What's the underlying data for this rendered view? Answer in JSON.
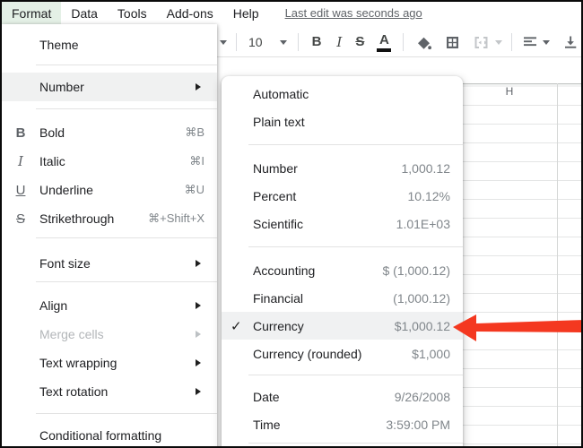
{
  "menubar": {
    "items": [
      "Format",
      "Data",
      "Tools",
      "Add-ons",
      "Help"
    ],
    "active_item": "Format",
    "status_text": "Last edit was seconds ago"
  },
  "toolbar": {
    "font_size_value": "10",
    "bold_label": "B",
    "italic_label": "I",
    "strikethrough_label": "S",
    "text_color_label": "A"
  },
  "format_menu": {
    "items": [
      {
        "label": "Theme"
      },
      {
        "label": "Number",
        "has_submenu": true,
        "highlighted": true
      },
      {
        "label": "Bold",
        "icon_glyph": "B",
        "shortcut": "⌘B"
      },
      {
        "label": "Italic",
        "icon_glyph": "I",
        "shortcut": "⌘I"
      },
      {
        "label": "Underline",
        "icon_glyph": "U",
        "shortcut": "⌘U"
      },
      {
        "label": "Strikethrough",
        "icon_glyph": "S",
        "shortcut": "⌘+Shift+X"
      },
      {
        "label": "Font size",
        "has_submenu": true
      },
      {
        "label": "Align",
        "has_submenu": true
      },
      {
        "label": "Merge cells",
        "has_submenu": true,
        "disabled": true
      },
      {
        "label": "Text wrapping",
        "has_submenu": true
      },
      {
        "label": "Text rotation",
        "has_submenu": true
      },
      {
        "label": "Conditional formatting"
      }
    ]
  },
  "number_submenu": {
    "checkmark_glyph": "✓",
    "items": [
      {
        "label": "Automatic"
      },
      {
        "label": "Plain text"
      },
      {
        "label": "Number",
        "example": "1,000.12"
      },
      {
        "label": "Percent",
        "example": "10.12%"
      },
      {
        "label": "Scientific",
        "example": "1.01E+03"
      },
      {
        "label": "Accounting",
        "example": "$ (1,000.12)"
      },
      {
        "label": "Financial",
        "example": "(1,000.12)"
      },
      {
        "label": "Currency",
        "example": "$1,000.12",
        "checked": true,
        "highlighted": true
      },
      {
        "label": "Currency (rounded)",
        "example": "$1,000"
      },
      {
        "label": "Date",
        "example": "9/26/2008"
      },
      {
        "label": "Time",
        "example": "3:59:00 PM"
      }
    ]
  },
  "sheet": {
    "visible_column_header": "H"
  },
  "annotation": {
    "type": "red-arrow",
    "points_at": "Currency",
    "color": "#f43820"
  },
  "colors": {
    "menu_active_bg": "#e4f0e6",
    "row_highlight": "#f0f1f2",
    "example_text": "#80868b",
    "label_text": "#202124",
    "arrow_red": "#f43820"
  }
}
